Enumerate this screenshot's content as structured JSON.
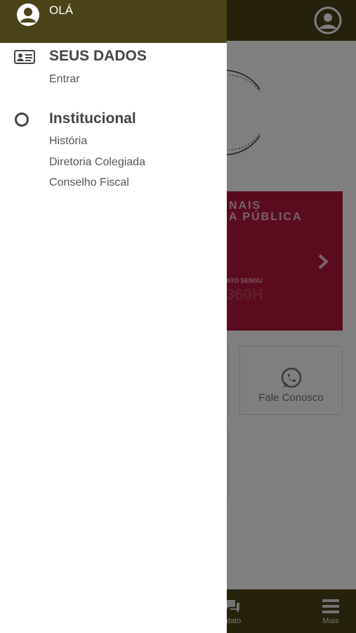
{
  "drawer": {
    "header": {
      "greeting": "OLÁ"
    },
    "sections": [
      {
        "title": "SEUS DADOS",
        "icon": "id-card-icon",
        "items": [
          "Entrar"
        ]
      },
      {
        "title": "Institucional",
        "icon": "circle-icon",
        "items": [
          "História",
          "Diretoria Colegiada",
          "Conselho Fiscal"
        ]
      }
    ]
  },
  "background": {
    "banner": {
      "line1": "NAIS",
      "line2": "A PÚBLICA",
      "line3": "ATO SENSU",
      "line4": "360H"
    },
    "cards": [
      {
        "label": "Fale Conosco",
        "icon": "whatsapp-icon"
      }
    ],
    "bottom_nav": [
      {
        "label": "ntato",
        "icon": "chat-icon"
      },
      {
        "label": "Mais",
        "icon": "menu-icon"
      }
    ]
  },
  "colors": {
    "header": "#4a4317",
    "banner": "#b5193c",
    "overlay": "rgba(0,0,0,0.5)"
  }
}
